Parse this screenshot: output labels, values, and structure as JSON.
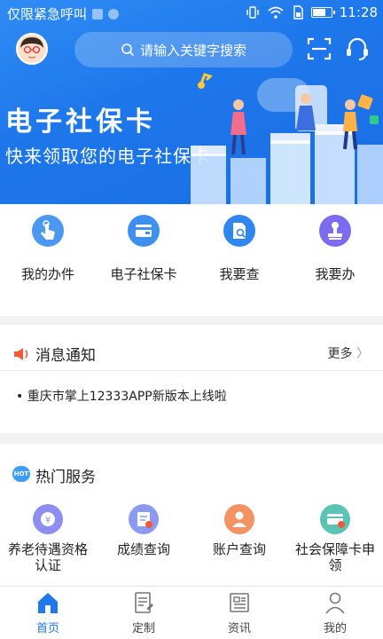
{
  "status_bar": {
    "carrier_text": "仅限紧急呼叫",
    "time": "11:28",
    "battery_level": 0.75
  },
  "header": {
    "search_placeholder": "请输入关键字搜索",
    "banner_title": "电子社保卡",
    "banner_subtitle": "快来领取您的电子社保卡"
  },
  "quick_actions": [
    {
      "label": "我的办件",
      "icon": "touch-icon",
      "color": "#4a98f0"
    },
    {
      "label": "电子社保卡",
      "icon": "card-wallet-icon",
      "color": "#3e8ff0"
    },
    {
      "label": "我要查",
      "icon": "document-search-icon",
      "color": "#2f86ee"
    },
    {
      "label": "我要办",
      "icon": "stamp-icon",
      "color": "#7b6cf0"
    }
  ],
  "notice": {
    "title": "消息通知",
    "more": "更多",
    "items": [
      "• 重庆市掌上12333APP新版本上线啦"
    ]
  },
  "hot_services": {
    "badge": "HOT",
    "title": "热门服务",
    "items": [
      {
        "label": "养老待遇资格认证",
        "icon": "pension-icon",
        "color": "#8e8ef2"
      },
      {
        "label": "成绩查询",
        "icon": "score-query-icon",
        "color": "#8c9bf2"
      },
      {
        "label": "账户查询",
        "icon": "account-user-icon",
        "color": "#f39263"
      },
      {
        "label": "社会保障卡申领",
        "icon": "social-card-icon",
        "color": "#59c4b4"
      }
    ]
  },
  "tabbar": [
    {
      "label": "首页",
      "icon": "home-icon",
      "active": true
    },
    {
      "label": "定制",
      "icon": "customize-icon",
      "active": false
    },
    {
      "label": "资讯",
      "icon": "news-icon",
      "active": false
    },
    {
      "label": "我的",
      "icon": "profile-icon",
      "active": false
    }
  ],
  "colors": {
    "brand_blue": "#1f79ea",
    "notice_red": "#f05a3a"
  }
}
